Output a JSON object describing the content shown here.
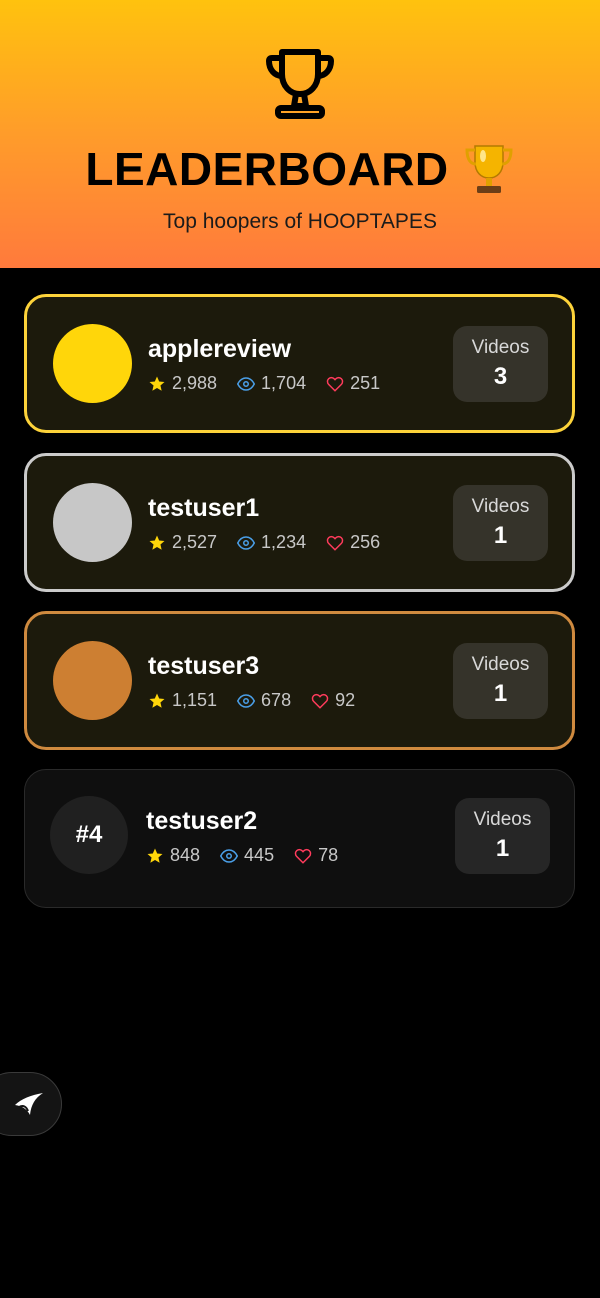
{
  "header": {
    "title": "LEADERBOARD",
    "subtitle": "Top hoopers of HOOPTAPES",
    "icons": [
      "trophy-outline-icon",
      "trophy-emoji-icon"
    ]
  },
  "leaderboard": [
    {
      "rank": 1,
      "avatar_color": "#ffd60a",
      "border_color": "#fdd33a",
      "username": "applereview",
      "stars": "2,988",
      "views": "1,704",
      "likes": "251",
      "videos_label": "Videos",
      "videos": "3"
    },
    {
      "rank": 2,
      "avatar_color": "#c7c7c7",
      "border_color": "#cbcbcb",
      "username": "testuser1",
      "stars": "2,527",
      "views": "1,234",
      "likes": "256",
      "videos_label": "Videos",
      "videos": "1"
    },
    {
      "rank": 3,
      "avatar_color": "#cd7f32",
      "border_color": "#cf8a3f",
      "username": "testuser3",
      "stars": "1,151",
      "views": "678",
      "likes": "92",
      "videos_label": "Videos",
      "videos": "1"
    },
    {
      "rank": 4,
      "rank_label": "#4",
      "avatar_color": "#202020",
      "username": "testuser2",
      "stars": "848",
      "views": "445",
      "likes": "78",
      "videos_label": "Videos",
      "videos": "1"
    }
  ],
  "colors": {
    "star": "#ffd60a",
    "eye": "#4a9fe8",
    "heart": "#ff3b5c"
  },
  "fab": {
    "icon": "app-logo-icon"
  }
}
